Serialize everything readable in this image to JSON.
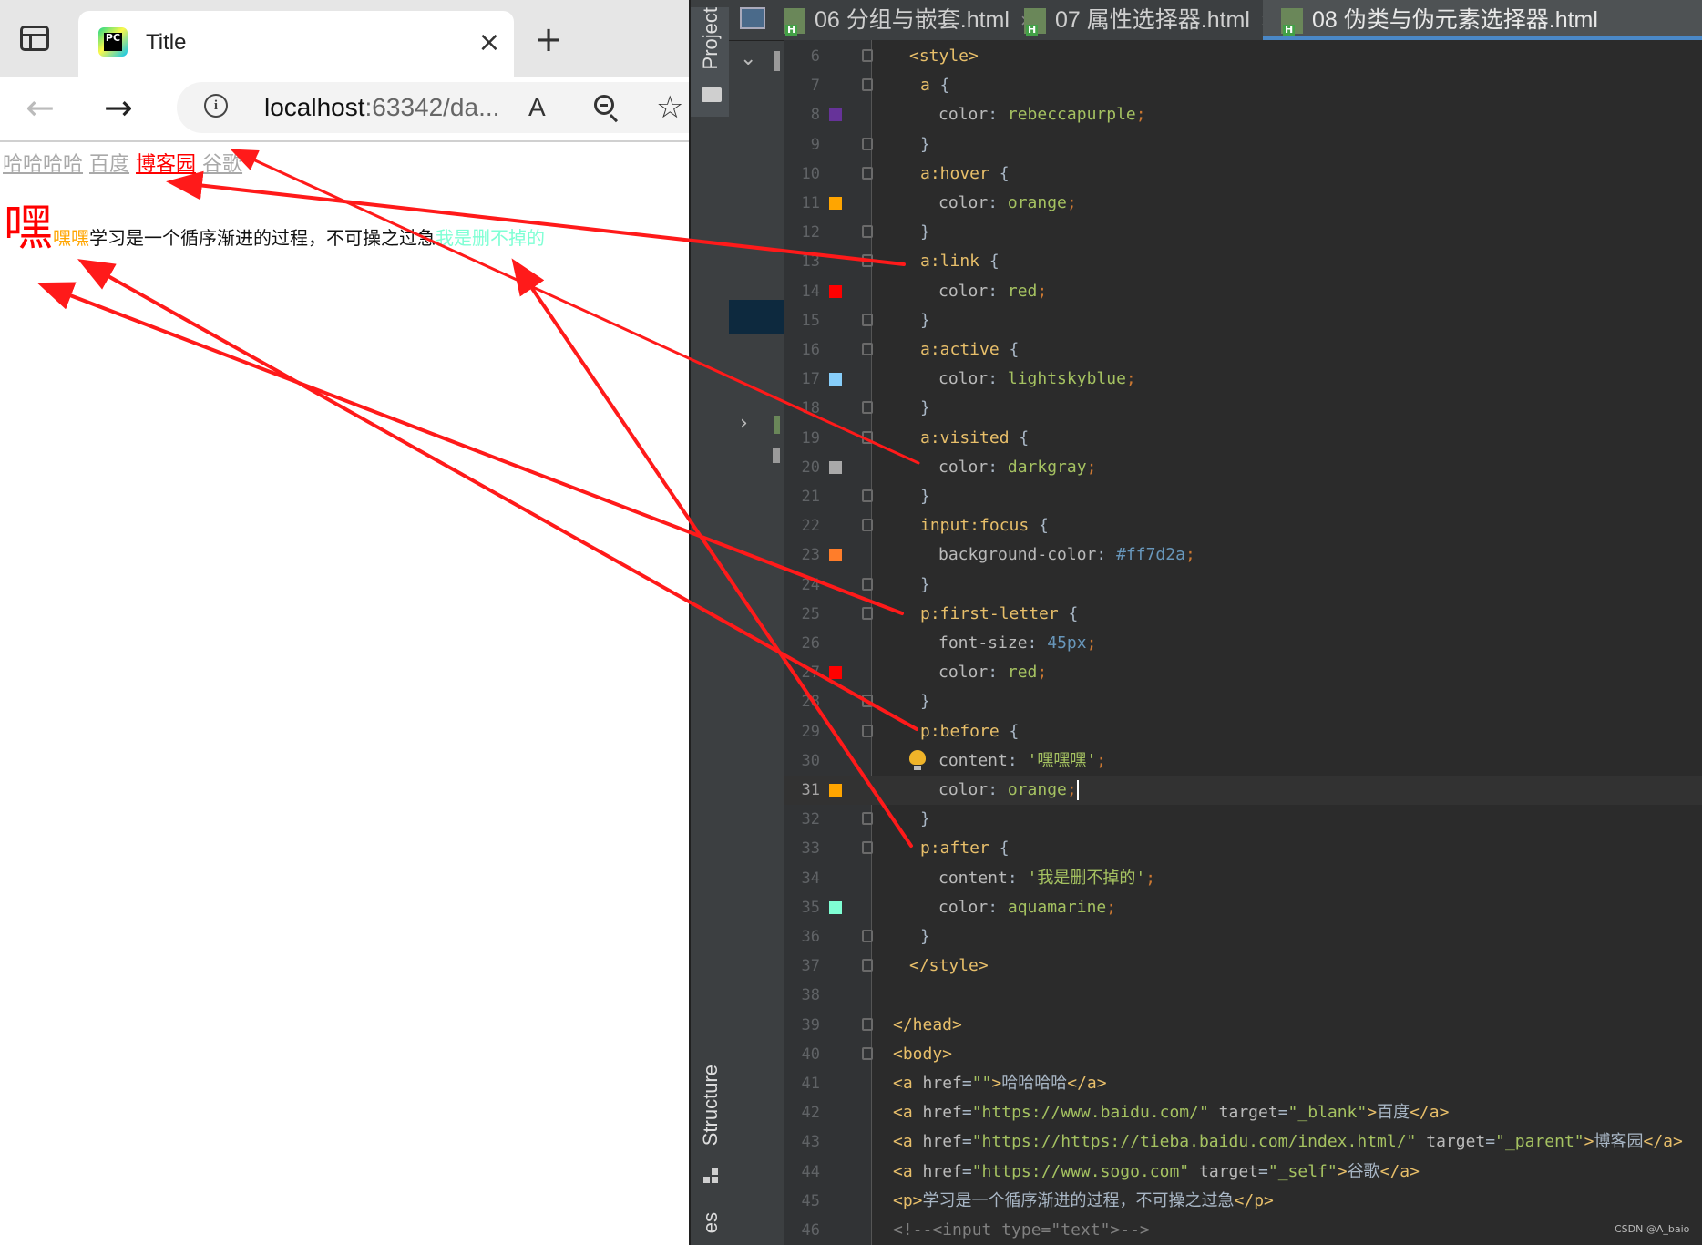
{
  "browser": {
    "tab_title": "Title",
    "tab_close": "×",
    "new_tab": "+",
    "back": "←",
    "forward": "→",
    "info": "i",
    "url_host": "localhost",
    "url_rest": ":63342/da...",
    "read_aloud": "A",
    "favorites": "☆",
    "links": [
      "哈哈哈哈",
      "百度",
      "博客园",
      "谷歌"
    ],
    "para_first_letter": "嘿",
    "para_before": "嘿嘿",
    "para_text": "学习是一个循序渐进的过程，不可操之过急",
    "para_after": "我是删不掉的"
  },
  "ide": {
    "vtab_project": "Project",
    "vtab_structure": "Structure",
    "vtab_bottom": "es",
    "tabs": [
      {
        "label": "06 分组与嵌套.html",
        "close": "×"
      },
      {
        "label": "07 属性选择器.html",
        "close": "×"
      },
      {
        "label": "08 伪类与伪元素选择器.html",
        "close": ""
      }
    ],
    "lines": [
      "6",
      "7",
      "8",
      "9",
      "10",
      "11",
      "12",
      "13",
      "14",
      "15",
      "16",
      "17",
      "18",
      "19",
      "20",
      "21",
      "22",
      "23",
      "24",
      "25",
      "26",
      "27",
      "28",
      "29",
      "30",
      "31",
      "32",
      "33",
      "34",
      "35",
      "36",
      "37",
      "38",
      "39",
      "40",
      "41",
      "42",
      "43",
      "44",
      "45",
      "46"
    ],
    "code": {
      "l6": "<style>",
      "l7_sel": "a",
      "l7_b": " {",
      "l8_prop": "color",
      "l8_val": "rebeccapurple",
      "l9": "}",
      "l10_sel": "a:hover",
      "l10_b": " {",
      "l11_prop": "color",
      "l11_val": "orange",
      "l12": "}",
      "l13_sel": "a:link",
      "l13_b": " {",
      "l14_prop": "color",
      "l14_val": "red",
      "l15": "}",
      "l16_sel": "a:active",
      "l16_b": " {",
      "l17_prop": "color",
      "l17_val": "lightskyblue",
      "l18": "}",
      "l19_sel": "a:visited",
      "l19_b": " {",
      "l20_prop": "color",
      "l20_val": "darkgray",
      "l21": "}",
      "l22_sel": "input:focus",
      "l22_b": " {",
      "l23_prop": "background-color",
      "l23_val": "#ff7d2a",
      "l24": "}",
      "l25_sel": "p:first-letter",
      "l25_b": " {",
      "l26_prop": "font-size",
      "l26_val": "45px",
      "l27_prop": "color",
      "l27_val": "red",
      "l28": "}",
      "l29_sel": "p:before",
      "l29_b": " {",
      "l30_prop": "content",
      "l30_val": "'嘿嘿嘿'",
      "l31_prop": "color",
      "l31_val": "orange",
      "l32": "}",
      "l33_sel": "p:after",
      "l33_b": " {",
      "l34_prop": "content",
      "l34_val": "'我是删不掉的'",
      "l35_prop": "color",
      "l35_val": "aquamarine",
      "l36": "}",
      "l37": "</style>",
      "l39": "</head>",
      "l40": "<body>",
      "l41_open": "<a ",
      "l41_attr": "href",
      "l41_str": "\"\"",
      "l41_gt": ">",
      "l41_txt": "哈哈哈哈",
      "l41_close": "</a>",
      "l42_open": "<a ",
      "l42_attr": "href",
      "l42_str": "\"https://www.baidu.com/\"",
      "l42_attr2": "target",
      "l42_str2": "\"_blank\"",
      "l42_gt": ">",
      "l42_txt": "百度",
      "l42_close": "</a>",
      "l43_open": "<a ",
      "l43_attr": "href",
      "l43_str": "\"https://https://tieba.baidu.com/index.html/\"",
      "l43_attr2": "target",
      "l43_str2": "\"_parent\"",
      "l43_gt": ">",
      "l43_txt": "博客园",
      "l43_close": "</a>",
      "l44_open": "<a ",
      "l44_attr": "href",
      "l44_str": "\"https://www.sogo.com\"",
      "l44_attr2": "target",
      "l44_str2": "\"_self\"",
      "l44_gt": ">",
      "l44_txt": "谷歌",
      "l44_close": "</a>",
      "l45_open": "<p>",
      "l45_txt": "学习是一个循序渐进的过程，不可操之过急",
      "l45_close": "</p>",
      "l46": "<!--<input type=\"text\">-->"
    },
    "swatch_colors": {
      "l8": "#663399",
      "l11": "#ffa500",
      "l14": "#ff0000",
      "l17": "#87cefa",
      "l20": "#a9a9a9",
      "l23": "#ff7d2a",
      "l27": "#ff0000",
      "l31": "#ffa500",
      "l35": "#7fffd4"
    }
  },
  "watermark": "CSDN @A_baio"
}
